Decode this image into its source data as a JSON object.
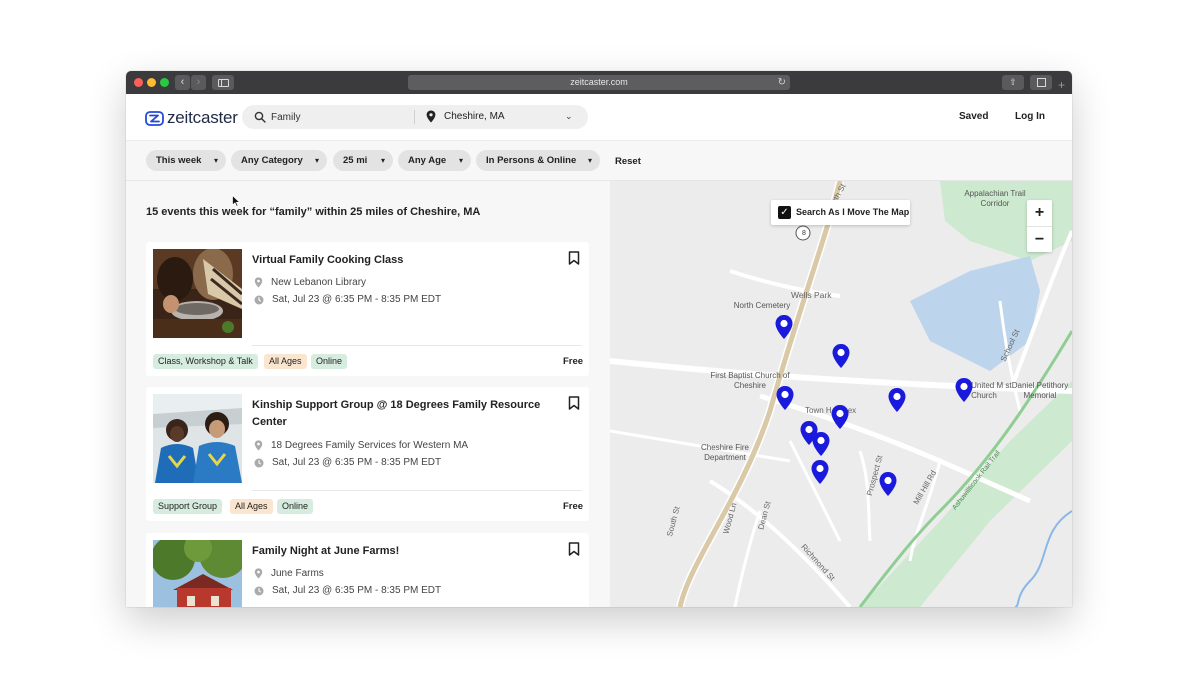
{
  "browser": {
    "url": "zeitcaster.com"
  },
  "header": {
    "logo_text": "zeitcaster",
    "search_value": "Family",
    "location_value": "Cheshire, MA",
    "saved_label": "Saved",
    "login_label": "Log In"
  },
  "filters": {
    "chips": [
      "This week",
      "Any Category",
      "25 mi",
      "Any Age",
      "In Persons & Online"
    ],
    "reset_label": "Reset"
  },
  "results": {
    "heading": "15 events this week for “family” within 25 miles of Cheshire, MA",
    "events": [
      {
        "title": "Virtual Family Cooking Class",
        "location": "New Lebanon Library",
        "time": "Sat, Jul 23 @ 6:35 PM - 8:35 PM EDT",
        "tags": [
          "Class, Workshop & Talk",
          "All Ages",
          "Online"
        ],
        "price": "Free"
      },
      {
        "title": "Kinship Support Group @ 18 Degrees Family Resource Center",
        "location": "18 Degrees Family Services for Western MA",
        "time": "Sat, Jul 23 @ 6:35 PM - 8:35 PM EDT",
        "tags": [
          "Support Group",
          "All Ages",
          "Online"
        ],
        "price": "Free"
      },
      {
        "title": "Family Night at June Farms!",
        "location": "June Farms",
        "time": "Sat, Jul 23 @ 6:35 PM - 8:35 PM EDT",
        "tags": [],
        "price": ""
      }
    ]
  },
  "map": {
    "toggle_label": "Search As I Move The Map",
    "zoom_in": "+",
    "zoom_out": "−",
    "places": {
      "trail_corridor": "Appalachian Trail Corridor",
      "cemetery": "North Cemetery",
      "wells_park": "Wells Park",
      "baptist": "First Baptist Church of Cheshire",
      "town_annex": "Town H  Annex",
      "fire_dept": "Cheshire Fire Department",
      "methodist": "C   e United M   st Church",
      "memorial": "Daniel Petithory Memorial",
      "route_marker": "8"
    },
    "streets": {
      "north_st": "North St",
      "school_st": "School St",
      "south_st": "South St",
      "wood_ln": "Wood Ln",
      "dean_st": "Dean St",
      "richmond_st": "Richmond St",
      "prospect_st": "Prospect St",
      "mill_hill_rd": "Mill Hill Rd",
      "rail_trail": "Ashuwillticook Rail Trail"
    }
  },
  "colors": {
    "pin": "#1a1adc",
    "tag_green": "#d6ecdf",
    "tag_orange": "#fae6cf"
  }
}
